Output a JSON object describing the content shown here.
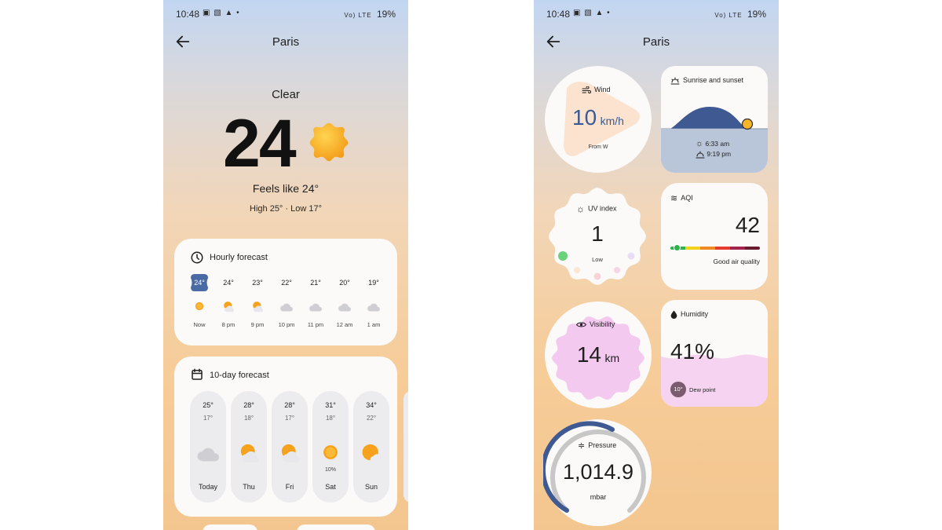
{
  "status_bar": {
    "time": "10:48",
    "left_icons": "▣ ▧ ▲ •",
    "signal": "Vo) LTE",
    "battery": "19%"
  },
  "appbar": {
    "city": "Paris"
  },
  "current": {
    "condition": "Clear",
    "temperature": "24",
    "feels_like": "Feels like 24°",
    "high_low": "High 25° · Low 17°",
    "icon": "sun-icon"
  },
  "hourly": {
    "title": "Hourly forecast",
    "items": [
      {
        "temp": "24°",
        "label": "Now",
        "icon": "sun"
      },
      {
        "temp": "24°",
        "label": "8 pm",
        "icon": "partly-cloudy"
      },
      {
        "temp": "23°",
        "label": "9 pm",
        "icon": "partly-cloudy"
      },
      {
        "temp": "22°",
        "label": "10 pm",
        "icon": "cloud"
      },
      {
        "temp": "21°",
        "label": "11 pm",
        "icon": "cloud"
      },
      {
        "temp": "20°",
        "label": "12 am",
        "icon": "cloud"
      },
      {
        "temp": "19°",
        "label": "1 am",
        "icon": "cloud"
      }
    ]
  },
  "daily": {
    "title": "10-day forecast",
    "items": [
      {
        "high": "25°",
        "low": "17°",
        "label": "Today",
        "icon": "cloud",
        "precip": ""
      },
      {
        "high": "28°",
        "low": "18°",
        "label": "Thu",
        "icon": "partly-cloudy",
        "precip": ""
      },
      {
        "high": "28°",
        "low": "17°",
        "label": "Fri",
        "icon": "partly-cloudy",
        "precip": ""
      },
      {
        "high": "31°",
        "low": "18°",
        "label": "Sat",
        "icon": "sun",
        "precip": "10%"
      },
      {
        "high": "34°",
        "low": "22°",
        "label": "Sun",
        "icon": "partly-sunny",
        "precip": ""
      }
    ]
  },
  "tiles": {
    "wind": {
      "title": "Wind",
      "value": "10",
      "unit": "km/h",
      "direction": "From W"
    },
    "sun": {
      "title": "Sunrise and sunset",
      "sunrise": "6:33 am",
      "sunset": "9:19 pm"
    },
    "uv": {
      "title": "UV index",
      "value": "1",
      "label": "Low"
    },
    "aqi": {
      "title": "AQI",
      "value": "42",
      "label": "Good air quality",
      "level": 0.07
    },
    "visibility": {
      "title": "Visibility",
      "value": "14",
      "unit": "km"
    },
    "humidity": {
      "title": "Humidity",
      "value": "41%",
      "dew_point": "10°",
      "dew_label": "Dew point",
      "level": 0.41
    },
    "pressure": {
      "title": "Pressure",
      "value": "1,014.9",
      "unit": "mbar"
    }
  },
  "colors": {
    "accent_blue": "#3f5a92",
    "sun_orange": "#f7a21d",
    "humidity_pink": "#f6d3f1",
    "visibility_pink": "#f4c9f0"
  }
}
